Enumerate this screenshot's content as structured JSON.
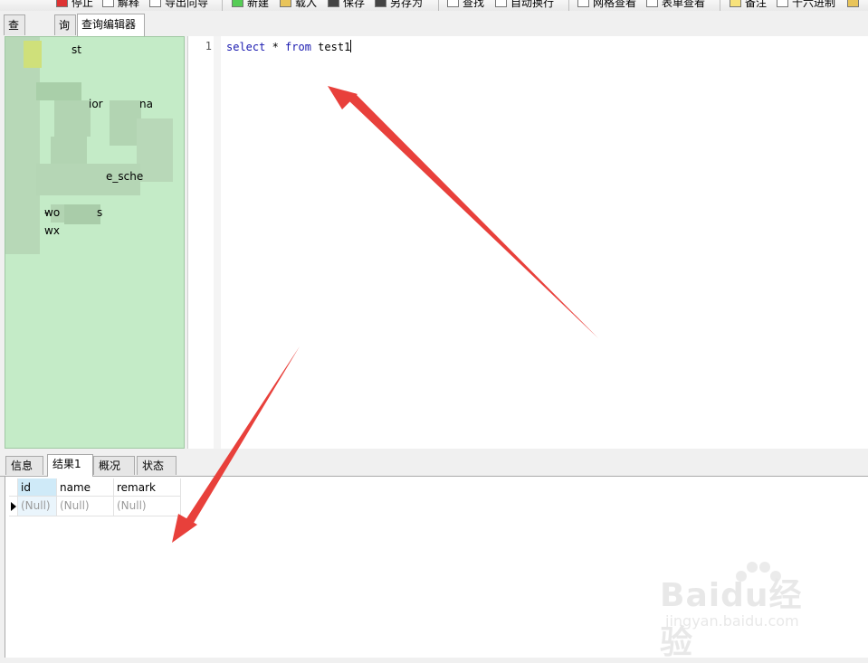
{
  "toolbar": {
    "items": [
      "停止",
      "解释",
      "导出向导",
      "新建",
      "载入",
      "保存",
      "另存为",
      "查找",
      "自动换行",
      "网格查看",
      "表单查看",
      "备注",
      "十六进制"
    ]
  },
  "top_tabs": {
    "first": "查",
    "second": "询",
    "active": "查询编辑器"
  },
  "tree": {
    "items": [
      "st",
      "ior",
      "na",
      "e_sche",
      "wo",
      "s",
      "wx"
    ]
  },
  "editor": {
    "line_number": "1",
    "code": {
      "kw1": "select",
      "star": " * ",
      "kw2": "from",
      "table": " test1"
    }
  },
  "bottom_tabs": [
    "信息",
    "结果1",
    "概况",
    "状态"
  ],
  "result": {
    "columns": [
      "id",
      "name",
      "remark"
    ],
    "row": [
      "(Null)",
      "(Null)",
      "(Null)"
    ]
  },
  "watermark": {
    "logo": "Baidu经验",
    "url": "jingyan.baidu.com"
  },
  "colors": {
    "tree_bg": "#c4ebc7",
    "keyword": "#1a1ab0",
    "arrow": "#e8403b"
  }
}
